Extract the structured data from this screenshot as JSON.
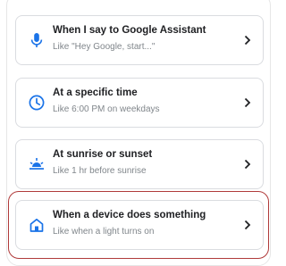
{
  "starters": [
    {
      "title": "When I say to Google Assistant",
      "subtitle": "Like \"Hey Google, start...\"",
      "icon": "microphone-icon"
    },
    {
      "title": "At a specific time",
      "subtitle": "Like 6:00 PM on weekdays",
      "icon": "clock-icon"
    },
    {
      "title": "At sunrise or sunset",
      "subtitle": "Like 1 hr before sunrise",
      "icon": "sunrise-icon"
    },
    {
      "title": "When a device does something",
      "subtitle": "Like when a light turns on",
      "icon": "home-icon"
    }
  ],
  "colors": {
    "accent": "#1a73e8",
    "highlight": "#b03a3a"
  }
}
